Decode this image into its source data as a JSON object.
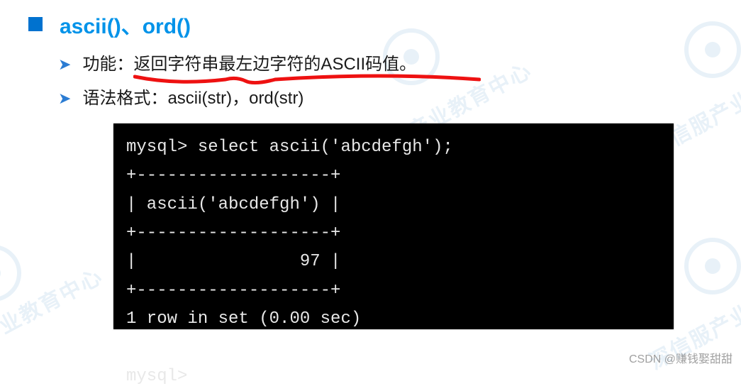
{
  "heading": "ascii()、ord()",
  "bullets": {
    "b1_label": "功能：",
    "b1_desc": "返回字符串最左边字符的ASCII码值。",
    "b2_label": "语法格式：",
    "b2_desc": "ascii(str)，ord(str)"
  },
  "terminal": {
    "line1": "mysql> select ascii('abcdefgh');",
    "line2": "+-------------------+",
    "line3": "| ascii('abcdefgh') |",
    "line4": "+-------------------+",
    "line5": "|                97 |",
    "line6": "+-------------------+",
    "line7": "1 row in set (0.00 sec)",
    "line8": "",
    "line9": "mysql>"
  },
  "footer": "CSDN @赚钱娶甜甜",
  "watermark_text": "深信服产业教育中心"
}
